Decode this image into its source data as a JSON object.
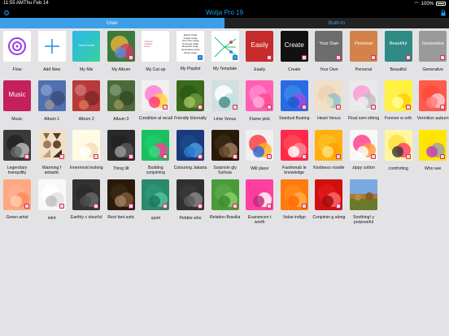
{
  "status": {
    "time": "11:55 AM",
    "date": "Thu Feb 14",
    "battery": "100%"
  },
  "app": {
    "title": "Wotja Pro 19"
  },
  "tabs": [
    {
      "label": "User",
      "active": true
    },
    {
      "label": "Built-In",
      "active": false
    }
  ],
  "colors": {
    "accent": "#1e9cf0",
    "tab_active": "#3d9ee8",
    "badge": "#c8305a"
  },
  "rows": [
    [
      {
        "label": "Flow",
        "style": "flow"
      },
      {
        "label": "Add New",
        "style": "add"
      },
      {
        "label": "My Mix",
        "style": "mymix",
        "caption": "home reveal"
      },
      {
        "label": "My Album",
        "style": "orb",
        "c": [
          "#e6b33a",
          "#d13b6b",
          "#5b8bd6"
        ],
        "bg": "#3b7a3a",
        "badge": true
      },
      {
        "label": "My Cut-up",
        "style": "cutup"
      },
      {
        "label": "My Playlist",
        "style": "playlist",
        "lines": [
          "Easily wotja",
          "Create wotja",
          "Your Own wotja",
          "Personal wotja",
          "Beautiful wotja",
          "Generative wotja",
          "Music wotja"
        ]
      },
      {
        "label": "My Template",
        "style": "template"
      },
      {
        "label": "Easily",
        "style": "word",
        "word": "Easily",
        "bg": "#c62a2a",
        "badge": true
      },
      {
        "label": "Create",
        "style": "word",
        "word": "Create",
        "bg": "#111111",
        "badge": true
      },
      {
        "label": "Your Own",
        "style": "word",
        "word": "Your Own",
        "bg": "#6d6d6d",
        "badge": true
      },
      {
        "label": "Personal",
        "style": "word",
        "word": "Personal",
        "bg": "#d4824a",
        "badge": true
      },
      {
        "label": "Beautiful",
        "style": "word",
        "word": "Beautiful",
        "bg": "#2f8a86",
        "badge": true
      },
      {
        "label": "Generative",
        "style": "word",
        "word": "Generative",
        "bg": "#9a9a9a",
        "badge": true
      }
    ],
    [
      {
        "label": "Music",
        "style": "word",
        "word": "Music",
        "bg": "#c4205a"
      },
      {
        "label": "Album 1",
        "style": "photo",
        "bg": "#5070b0"
      },
      {
        "label": "Album 2",
        "style": "photo",
        "bg": "#b83a3a"
      },
      {
        "label": "Album 3",
        "style": "photo",
        "bg": "#4a6a3a"
      },
      {
        "label": "Condition al recall",
        "style": "orb",
        "c": [
          "#ff7ad0",
          "#ffd43a",
          "#ff3a7a"
        ],
        "bg": "#f0f0f0",
        "badge": true
      },
      {
        "label": "Friendly Eternally",
        "style": "orb",
        "c": [
          "#2a5a18",
          "#6a9a3a",
          "#a0c060"
        ],
        "bg": "#3a6a1a",
        "badge": true
      },
      {
        "label": "Lime Venus",
        "style": "orb",
        "c": [
          "#ffffff",
          "#c0e0e0",
          "#4a8a8a"
        ],
        "bg": "#d0e0e0",
        "badge": true
      },
      {
        "label": "Flame pink",
        "style": "orb",
        "c": [
          "#ff8ad0",
          "#ff4a8a",
          "#ffb0e0"
        ],
        "bg": "#ff60b0",
        "badge": true
      },
      {
        "label": "Stardust floating",
        "style": "orb",
        "c": [
          "#3a8ae6",
          "#a04ae6",
          "#1a5ad0"
        ],
        "bg": "#2a6ae6",
        "badge": true
      },
      {
        "label": "Heart Venus",
        "style": "orb",
        "c": [
          "#f0d0b0",
          "#90c0d0",
          "#f0e0c0"
        ],
        "bg": "#efe0c8",
        "badge": true
      },
      {
        "label": "Float som ething",
        "style": "orb",
        "c": [
          "#ff9ad6",
          "#c0c0c0",
          "#f0f0f0"
        ],
        "bg": "#eaeaea",
        "badge": true
      },
      {
        "label": "Forever w orth",
        "style": "orb",
        "c": [
          "#fff04a",
          "#ffd000",
          "#ffffa0"
        ],
        "bg": "#fff23a",
        "badge": true
      },
      {
        "label": "Vermilion auburn",
        "style": "orb",
        "c": [
          "#ff4a3a",
          "#ffd0d0",
          "#ff8080"
        ],
        "bg": "#ff5a4a",
        "badge": true
      }
    ],
    [
      {
        "label": "Legendary tranquility",
        "style": "orb",
        "c": [
          "#222222",
          "#c0c0c0",
          "#666666"
        ],
        "bg": "#3a3a3a",
        "badge": true
      },
      {
        "label": "Warming f antastic",
        "style": "shapes",
        "bg": "#f0e0c8",
        "badge": true
      },
      {
        "label": "Innermost looking",
        "style": "orb",
        "c": [
          "#fff8e0",
          "#f0e0b0",
          "#ffffff"
        ],
        "bg": "#fffbe6",
        "badge": true
      },
      {
        "label": "Thing lilt",
        "style": "orb",
        "c": [
          "#222222",
          "#5a5a5a",
          "#999999"
        ],
        "bg": "#2a2a2a",
        "badge": true
      },
      {
        "label": "Building conjoining",
        "style": "orb",
        "c": [
          "#1ad06a",
          "#ff3a9a",
          "#2ae07a"
        ],
        "bg": "#1ac060",
        "badge": true
      },
      {
        "label": "Colouring Jakarta",
        "style": "orb",
        "c": [
          "#1a4a8a",
          "#4aa0e0",
          "#2a7ad0"
        ],
        "bg": "#1a3a7a",
        "badge": true
      },
      {
        "label": "Surprisin gly fuchsia",
        "style": "orb",
        "c": [
          "#3a2a1a",
          "#a08060",
          "#6a4a2a"
        ],
        "bg": "#2a1a0a",
        "badge": true
      },
      {
        "label": "Will place",
        "style": "orb",
        "c": [
          "#ff3a3a",
          "#ffb020",
          "#2a6ae0"
        ],
        "bg": "#f0f0f0",
        "badge": true
      },
      {
        "label": "Fashionab le knowledge",
        "style": "orb",
        "c": [
          "#ff4a5a",
          "#ff8a9a",
          "#ffffff"
        ],
        "bg": "#ff2a4a",
        "badge": true
      },
      {
        "label": "Kindness noodle",
        "style": "orb",
        "c": [
          "#ffc020",
          "#ffa000",
          "#ffe080"
        ],
        "bg": "#ffb010",
        "badge": true
      },
      {
        "label": "zippy cotton",
        "style": "orb",
        "c": [
          "#ff3a8a",
          "#ff9a3a",
          "#ffffff"
        ],
        "bg": "#f8f8f8",
        "badge": true
      },
      {
        "label": "comforting",
        "style": "orb",
        "c": [
          "#ffe03a",
          "#ff3a6a",
          "#3a3a3a"
        ],
        "bg": "#fff6a0",
        "badge": true
      },
      {
        "label": "Who see",
        "style": "orb",
        "c": [
          "#ffe000",
          "#a0a0a0",
          "#c040c0"
        ],
        "bg": "#ffe800",
        "badge": true
      }
    ],
    [
      {
        "label": "Green artist",
        "style": "orb",
        "c": [
          "#ffb090",
          "#ff8a5a",
          "#ffd0b0"
        ],
        "bg": "#ffa880",
        "badge": true
      },
      {
        "label": "mint",
        "style": "orb",
        "c": [
          "#ffffff",
          "#e0e0e0",
          "#c0c0c0"
        ],
        "bg": "#f8f8f8",
        "badge": true
      },
      {
        "label": "Earthly c olourful",
        "style": "orb",
        "c": [
          "#2a2a2a",
          "#6a6a6a",
          "#4a4a4a"
        ],
        "bg": "#333333",
        "badge": true
      },
      {
        "label": "Rest fant astic",
        "style": "orb",
        "c": [
          "#3a2a1a",
          "#7a5a3a",
          "#a08060"
        ],
        "bg": "#2a1a0a",
        "badge": true
      },
      {
        "label": "quiet",
        "style": "orb",
        "c": [
          "#2a9a7a",
          "#5ac0a0",
          "#1a7a5a"
        ],
        "bg": "#2a8a6a",
        "badge": true
      },
      {
        "label": "Pebble who",
        "style": "orb",
        "c": [
          "#3a3a3a",
          "#8a8a8a",
          "#5a5a5a"
        ],
        "bg": "#303030",
        "badge": true
      },
      {
        "label": "Relation Brasilia",
        "style": "orb",
        "c": [
          "#5aaa4a",
          "#8ad06a",
          "#3a8a2a"
        ],
        "bg": "#4a9a3a",
        "badge": true
      },
      {
        "label": "Evanescen t worth",
        "style": "orb",
        "c": [
          "#ff3a9a",
          "#ffffff",
          "#c02a7a"
        ],
        "bg": "#ff40a0",
        "badge": true
      },
      {
        "label": "Value indigo",
        "style": "orb",
        "c": [
          "#ff8a1a",
          "#ffb04a",
          "#ff6a0a"
        ],
        "bg": "#ff7a10",
        "badge": true
      },
      {
        "label": "Conjoinin g along",
        "style": "orb",
        "c": [
          "#e01a1a",
          "#ff6a6a",
          "#a00a0a"
        ],
        "bg": "#d01010",
        "badge": true
      },
      {
        "label": "Soothing! y purposeful",
        "style": "photo2",
        "bg": "#7aa0d0"
      }
    ]
  ]
}
